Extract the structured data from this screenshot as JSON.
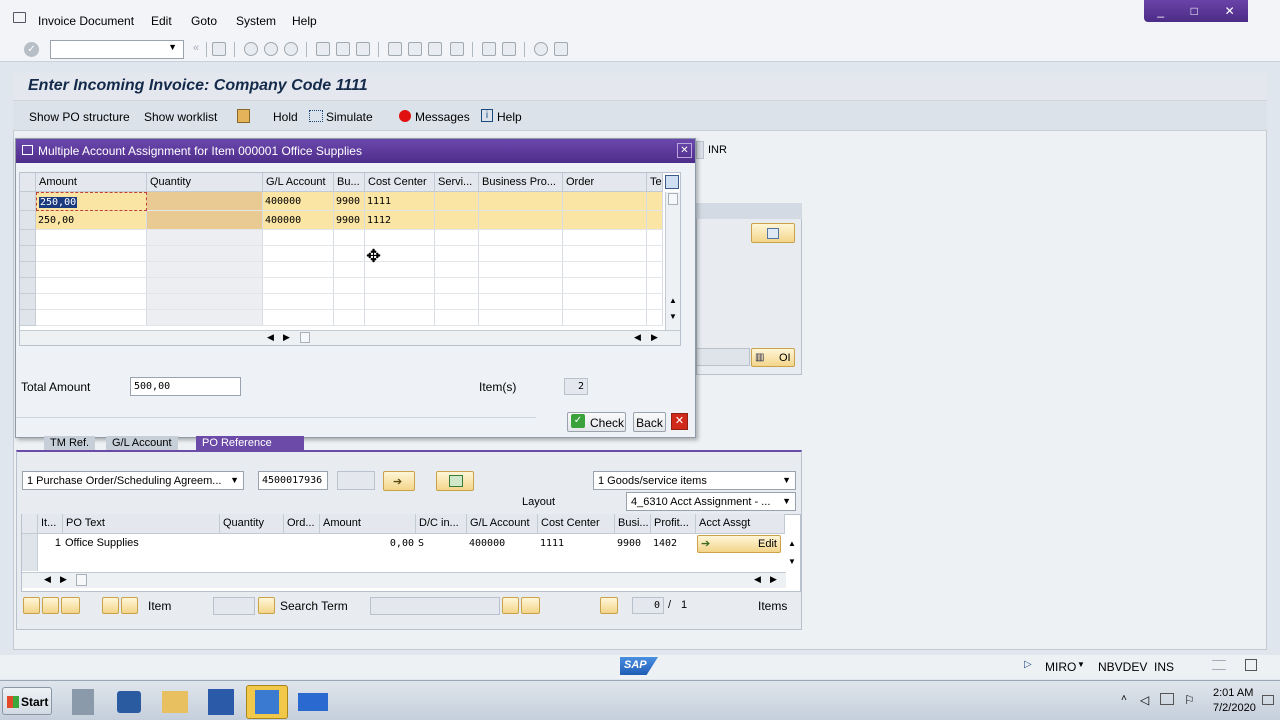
{
  "menubar": {
    "items": [
      "Invoice Document",
      "Edit",
      "Goto",
      "System",
      "Help"
    ]
  },
  "window_controls": [
    "_",
    "□",
    "✕"
  ],
  "page": {
    "title": "Enter Incoming Invoice: Company Code 1111",
    "app_toolbar": [
      "Show PO structure",
      "Show worklist",
      "Hold",
      "Simulate",
      "Messages",
      "Help"
    ],
    "currency": "INR",
    "oi_button": "OI"
  },
  "dialog": {
    "title": "Multiple Account Assignment for Item 000001 Office Supplies",
    "columns": [
      "Amount",
      "Quantity",
      "G/L Account",
      "Bu...",
      "Cost Center",
      "Servi...",
      "Business Pro...",
      "Order",
      "Te:"
    ],
    "rows": [
      {
        "amount": "250,00",
        "quantity": "",
        "gl_account": "400000",
        "bu": "9900",
        "cost_center": "1111"
      },
      {
        "amount": "250,00",
        "quantity": "",
        "gl_account": "400000",
        "bu": "9900",
        "cost_center": "1112"
      }
    ],
    "total_label": "Total Amount",
    "total_value": "500,00",
    "items_label": "Item(s)",
    "items_value": "2",
    "check_label": "Check",
    "back_label": "Back"
  },
  "tabs": [
    "TM Ref.",
    "G/L Account",
    "PO Reference"
  ],
  "po_section": {
    "reference_type": "1 Purchase Order/Scheduling Agreem...",
    "po_number": "4500017936",
    "item_type": "1 Goods/service items",
    "layout_label": "Layout",
    "layout_value": "4_6310 Acct Assignment - ...",
    "columns": [
      "It...",
      "PO Text",
      "Quantity",
      "Ord...",
      "Amount",
      "D/C in...",
      "G/L Account",
      "Cost Center",
      "Busi...",
      "Profit...",
      "Acct Assgt"
    ],
    "rows": [
      {
        "item": "1",
        "po_text": "Office Supplies",
        "quantity": "",
        "ord": "",
        "amount": "0,00",
        "dc": "S",
        "gl_account": "400000",
        "cost_center": "1111",
        "busi": "9900",
        "profit": "1402",
        "acct_assgt": "Edit"
      }
    ],
    "item_label": "Item",
    "search_term_label": "Search Term",
    "page_current": "0",
    "page_sep": "/",
    "page_total": "1",
    "items_label": "Items"
  },
  "status": {
    "logo": "SAP",
    "transaction": "MIRO",
    "system": "NBVDEV",
    "mode": "INS"
  },
  "taskbar": {
    "start_label": "Start",
    "time": "2:01 AM",
    "date": "7/2/2020"
  }
}
